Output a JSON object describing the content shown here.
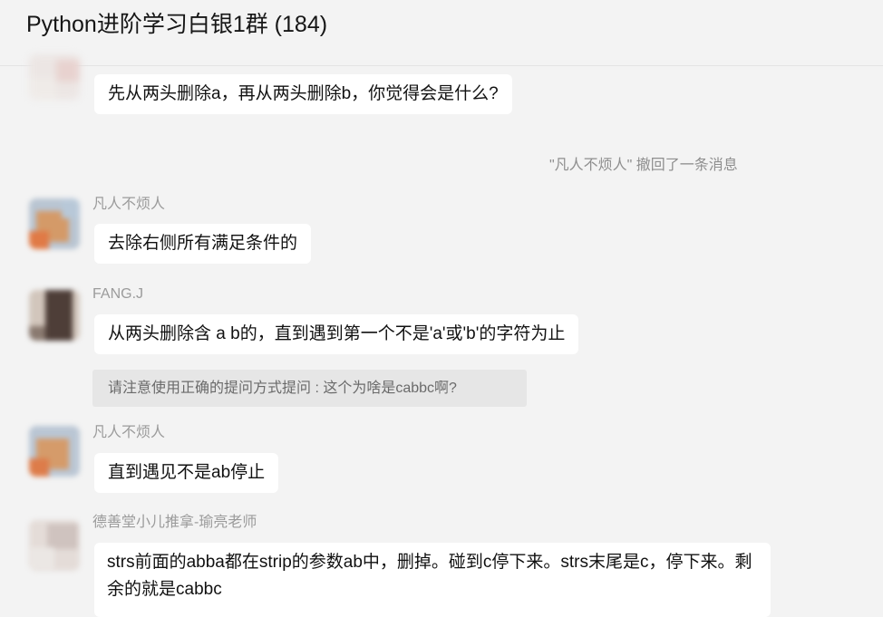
{
  "chat": {
    "title": "Python进阶学习白银1群 (184)"
  },
  "messages": [
    {
      "sender": "",
      "text": "先从两头删除a，再从两头删除b，你觉得会是什么?"
    },
    {
      "sender": "凡人不烦人",
      "text": "去除右侧所有满足条件的"
    },
    {
      "sender": "FANG.J",
      "text": "从两头删除含 a b的，直到遇到第一个不是'a'或'b'的字符为止",
      "quote": "请注意使用正确的提问方式提问 : 这个为啥是cabbc啊?"
    },
    {
      "sender": "凡人不烦人",
      "text": "直到遇见不是ab停止"
    },
    {
      "sender": "德善堂小儿推拿-瑜亮老师",
      "text": "strs前面的abba都在strip的参数ab中，删掉。碰到c停下来。strs末尾是c，停下来。剩余的就是cabbc"
    }
  ],
  "system": {
    "recall_notice": "\"凡人不烦人\" 撤回了一条消息"
  },
  "colors": {
    "background": "#f3f3f3",
    "bubble": "#ffffff",
    "quote_background": "#e6e6e6",
    "sender_name": "#9b9b9b"
  }
}
